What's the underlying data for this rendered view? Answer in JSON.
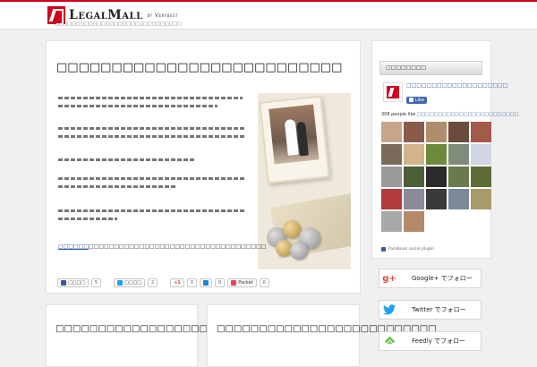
{
  "header": {
    "brand": "LegalMall",
    "by": "by Verybest",
    "tagline": "□□□□□□□□□□□□□□□□□□□□□□□□□□□□□□"
  },
  "post": {
    "title": "□□□□□□□□□□□□□□□□□□□□□□□□□□",
    "read_more_link": "□□□□□□",
    "read_more_rest": "□□□□□□□□□□□□□□□□□□□□□□□□□□□□□□□□□□□"
  },
  "social": {
    "fb_label": "□□□□",
    "fb_count": "5",
    "tw_label": "□□□□",
    "tw_count": "2",
    "gplus_label": "+1",
    "gplus_count": "0",
    "hatena_count": "0",
    "pocket_label": "Pocket",
    "pocket_count": "0"
  },
  "cards": [
    {
      "title": "□□□□□□□□□□□□□□□□□□□□□□□□□□□□□□"
    },
    {
      "title": "□□□□□□□□□□□□□□□□□□□□□□□□□□"
    }
  ],
  "sidebar": {
    "heading": "□□□□□□□□",
    "fb_page_name": "□□□□□□□□□□□□□□□□□□□□",
    "fb_like": "Like",
    "fb_people_count": "308 people like",
    "fb_people_page": "□□□□□□□□□□□□□□□□□□□□□□□□.",
    "fb_plugin": "Facebook social plugin",
    "face_colors": [
      "#c8a58a",
      "#8a5a4a",
      "#b08d6d",
      "#6b4b3a",
      "#a35c4a",
      "#7a6a5a",
      "#d3b48a",
      "#6d8a3a",
      "#7f8c7a",
      "#cfd5e2",
      "#9a9a9a",
      "#4a5f3a",
      "#2a2a2a",
      "#6a7a4a",
      "#5d6d3a",
      "#b23a3a",
      "#8a8a9a",
      "#3a3a3a",
      "#7a8a9a",
      "#a89a6a",
      "#a8a8a8",
      "#b28a6a"
    ],
    "follow": [
      {
        "label": "Google+ でフォロー",
        "icon": "g+",
        "color": "#dd4b39"
      },
      {
        "label": "Twitter でフォロー",
        "icon": "t",
        "color": "#1da1f2"
      },
      {
        "label": "Feedly でフォロー",
        "icon": "f",
        "color": "#6cc655"
      }
    ]
  }
}
